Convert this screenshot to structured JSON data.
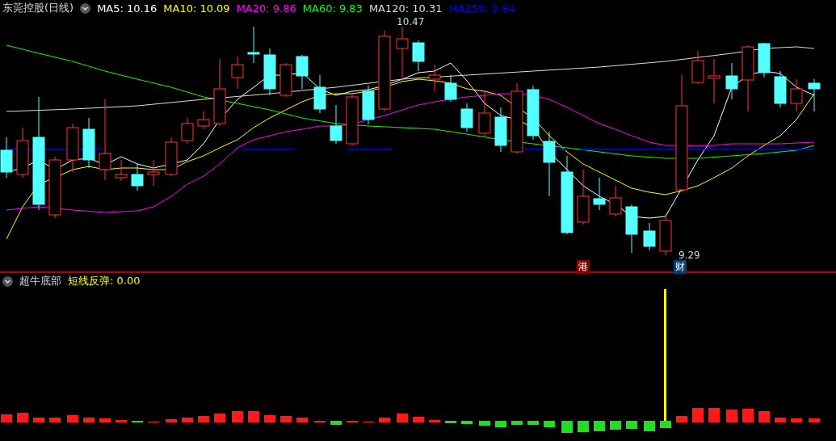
{
  "main_pane": {
    "title": "东莞控股(日线)",
    "averages": [
      {
        "text": "MA5: 10.16",
        "color": "#ffffff"
      },
      {
        "text": "MA10: 10.09",
        "color": "#ffff00"
      },
      {
        "text": "MA20: 9.86",
        "color": "#ff00ff"
      },
      {
        "text": "MA60: 9.83",
        "color": "#00ff00"
      },
      {
        "text": "MA120: 10.31",
        "color": "#dddddd"
      },
      {
        "text": "MA250: 9.84",
        "color": "#0000ff"
      }
    ],
    "high_label": "10.47",
    "low_label": "9.29",
    "badges": [
      {
        "text": "港",
        "color": "#8b0000"
      },
      {
        "text": "财",
        "color": "#0a3d6b"
      }
    ]
  },
  "indicator_pane": {
    "title": "超牛底部",
    "signal": {
      "text": "短线反弹: 0.00",
      "color": "#ffff00"
    }
  }
}
